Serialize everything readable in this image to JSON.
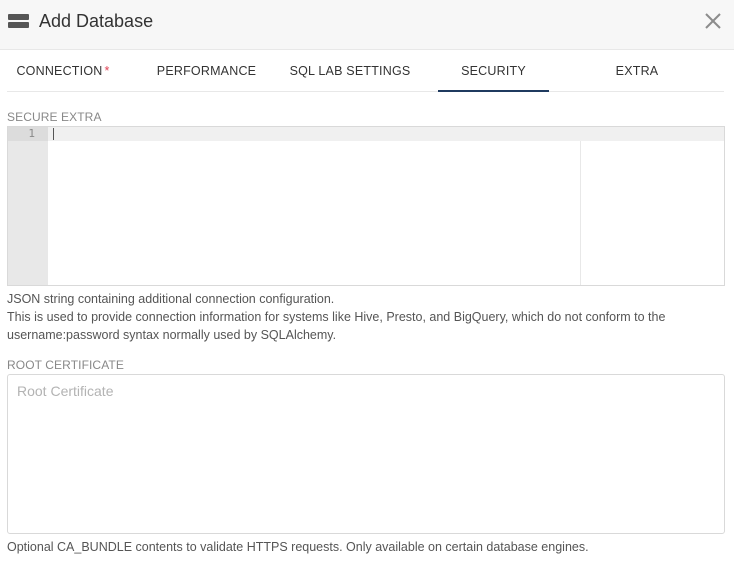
{
  "modal": {
    "title": "Add Database",
    "icons": {
      "database": "database-icon",
      "close": "close-icon"
    }
  },
  "tabs": [
    {
      "label": "CONNECTION",
      "required_marker": "*",
      "active": false
    },
    {
      "label": "PERFORMANCE",
      "active": false
    },
    {
      "label": "SQL LAB SETTINGS",
      "active": false
    },
    {
      "label": "SECURITY",
      "active": true
    },
    {
      "label": "EXTRA",
      "active": false
    }
  ],
  "secure_extra": {
    "label": "SECURE EXTRA",
    "line_number": "1",
    "value": "",
    "help_line1": "JSON string containing additional connection configuration.",
    "help_line2": "This is used to provide connection information for systems like Hive, Presto, and BigQuery, which do not conform to the",
    "help_line3": "username:password syntax normally used by SQLAlchemy."
  },
  "root_certificate": {
    "label": "ROOT CERTIFICATE",
    "placeholder": "Root Certificate",
    "value": "",
    "help": "Optional CA_BUNDLE contents to validate HTTPS requests. Only available on certain database engines."
  },
  "colors": {
    "active_tab_underline": "#1f3a5f",
    "required_marker": "#e04355",
    "header_bg": "#f7f7f7"
  }
}
